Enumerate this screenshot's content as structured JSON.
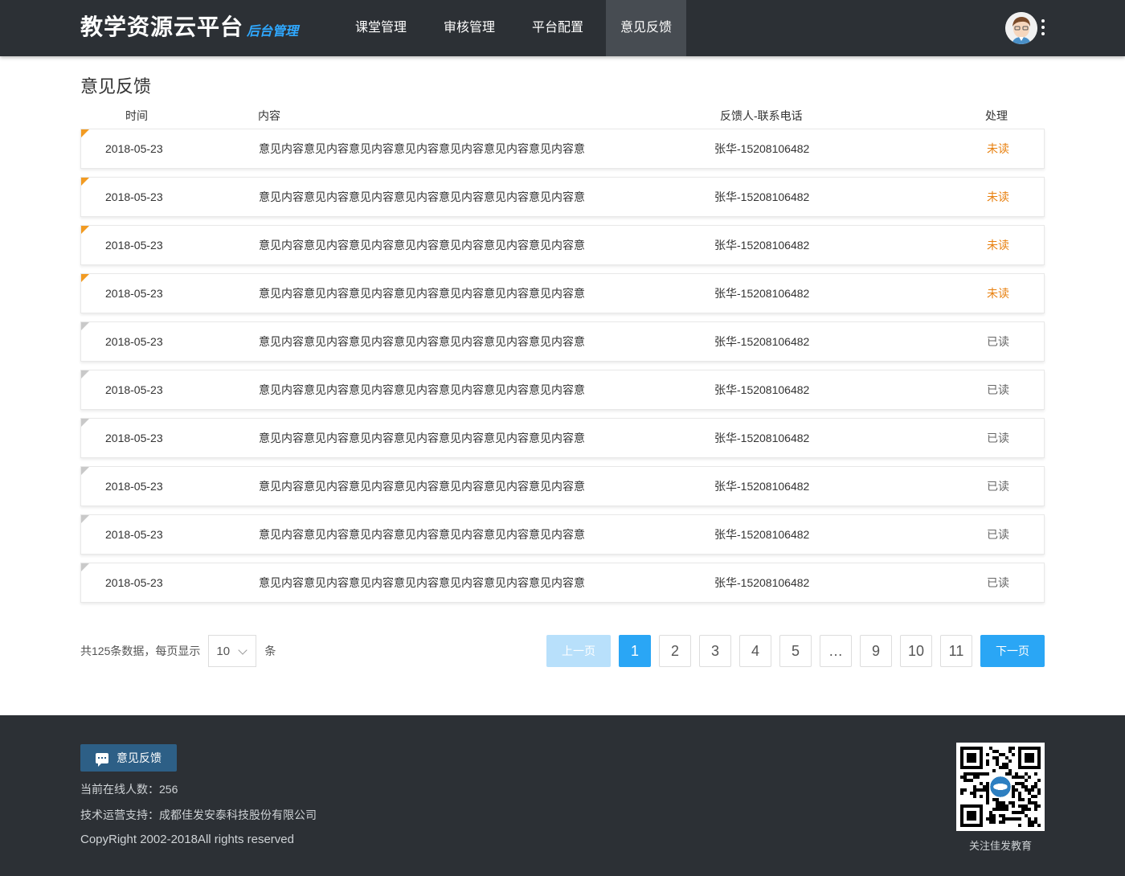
{
  "header": {
    "brand_main": "教学资源云平台",
    "brand_sub": "后台管理",
    "nav": [
      {
        "label": "课堂管理"
      },
      {
        "label": "审核管理"
      },
      {
        "label": "平台配置"
      },
      {
        "label": "意见反馈"
      }
    ]
  },
  "page": {
    "title": "意见反馈",
    "columns": {
      "time": "时间",
      "content": "内容",
      "contact": "反馈人-联系电话",
      "status": "处理"
    }
  },
  "rows": [
    {
      "time": "2018-05-23",
      "content": "意见内容意见内容意见内容意见内容意见内容意见内容意见内容意",
      "contact": "张华-15208106482",
      "status": "未读"
    },
    {
      "time": "2018-05-23",
      "content": "意见内容意见内容意见内容意见内容意见内容意见内容意见内容意",
      "contact": "张华-15208106482",
      "status": "未读"
    },
    {
      "time": "2018-05-23",
      "content": "意见内容意见内容意见内容意见内容意见内容意见内容意见内容意",
      "contact": "张华-15208106482",
      "status": "未读"
    },
    {
      "time": "2018-05-23",
      "content": "意见内容意见内容意见内容意见内容意见内容意见内容意见内容意",
      "contact": "张华-15208106482",
      "status": "未读"
    },
    {
      "time": "2018-05-23",
      "content": "意见内容意见内容意见内容意见内容意见内容意见内容意见内容意",
      "contact": "张华-15208106482",
      "status": "已读"
    },
    {
      "time": "2018-05-23",
      "content": "意见内容意见内容意见内容意见内容意见内容意见内容意见内容意",
      "contact": "张华-15208106482",
      "status": "已读"
    },
    {
      "time": "2018-05-23",
      "content": "意见内容意见内容意见内容意见内容意见内容意见内容意见内容意",
      "contact": "张华-15208106482",
      "status": "已读"
    },
    {
      "time": "2018-05-23",
      "content": "意见内容意见内容意见内容意见内容意见内容意见内容意见内容意",
      "contact": "张华-15208106482",
      "status": "已读"
    },
    {
      "time": "2018-05-23",
      "content": "意见内容意见内容意见内容意见内容意见内容意见内容意见内容意",
      "contact": "张华-15208106482",
      "status": "已读"
    },
    {
      "time": "2018-05-23",
      "content": "意见内容意见内容意见内容意见内容意见内容意见内容意见内容意",
      "contact": "张华-15208106482",
      "status": "已读"
    }
  ],
  "pagination": {
    "summary_prefix": "共125条数据，每页显示",
    "page_size": "10",
    "summary_suffix": "条",
    "prev": "上一页",
    "next": "下一页",
    "pages": [
      "1",
      "2",
      "3",
      "4",
      "5",
      "…",
      "9",
      "10",
      "11"
    ],
    "current": "1"
  },
  "footer": {
    "feedback_button": "意见反馈",
    "online_users": "当前在线人数：256",
    "tech_support": "技术运营支持：成都佳发安泰科技股份有限公司",
    "copyright": "CopyRight 2002-2018All rights reserved",
    "qr_caption": "关注佳发教育"
  },
  "colors": {
    "header_bg": "#2c3035",
    "accent_blue": "#2aa6f5",
    "unread_orange": "#e8800f",
    "unread_marker": "#f29b22",
    "read_marker": "#c9c9c9",
    "feedback_button": "#2d5f86"
  }
}
